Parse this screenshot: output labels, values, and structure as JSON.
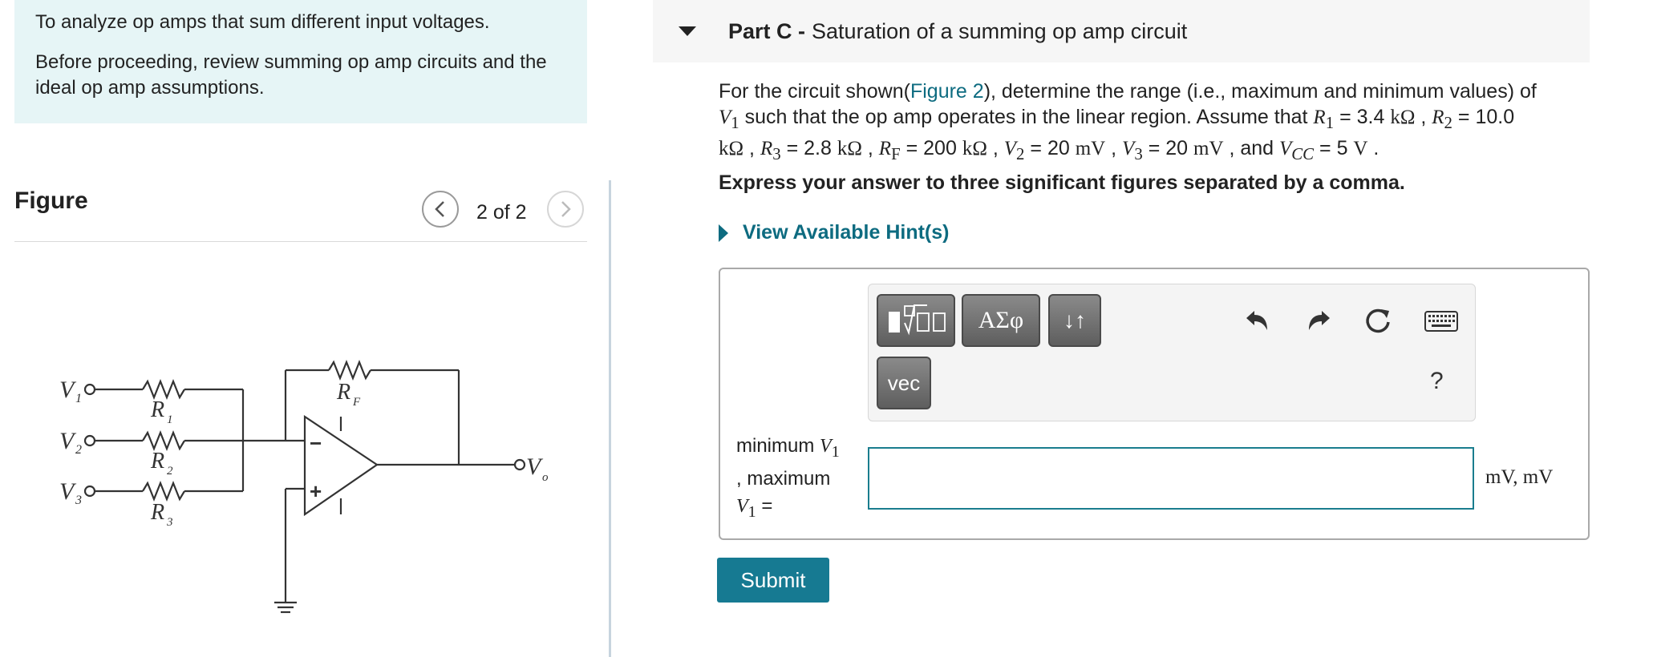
{
  "intro": {
    "line1": "To analyze op amps that sum different input voltages.",
    "line2": "Before proceeding, review summing op amp circuits and the ideal op amp assumptions."
  },
  "figure": {
    "title": "Figure",
    "page_indicator": "2 of 2",
    "labels": {
      "v1": "V",
      "v1_sub": "1",
      "v2": "V",
      "v2_sub": "2",
      "v3": "V",
      "v3_sub": "3",
      "r1": "R",
      "r1_sub": "1",
      "r2": "R",
      "r2_sub": "2",
      "r3": "R",
      "r3_sub": "3",
      "rf": "R",
      "rf_sub": "F",
      "vo": "V",
      "vo_sub": "o",
      "minus": "−",
      "plus": "+"
    }
  },
  "part": {
    "label": "Part C -",
    "title": "Saturation of a summing op amp circuit"
  },
  "question": {
    "t1": "For the circuit shown(",
    "figure_link": "Figure 2",
    "t2": "), determine the range (i.e., maximum and minimum values) of",
    "v1_sym": "V",
    "v1_sub": "1",
    "t3": " such that the op amp operates in the linear region. Assume that ",
    "r1_sym": "R",
    "r1_sub": "1",
    "r1_val": " = 3.4 ",
    "r1_unit": "kΩ",
    "r2_sym": "R",
    "r2_sub": "2",
    "r2_val": " = 10.0",
    "r2_unit": "kΩ",
    "r3_sym": "R",
    "r3_sub": "3",
    "r3_val": " = 2.8 ",
    "r3_unit": "kΩ",
    "rf_sym": "R",
    "rf_sub": "F",
    "rf_val": " = 200 ",
    "rf_unit": "kΩ",
    "v2_sym": "V",
    "v2_sub": "2",
    "v2_val": " = 20 ",
    "v2_unit": "mV",
    "v3_sym": "V",
    "v3_sub": "3",
    "v3_val": " = 20 ",
    "v3_unit": "mV",
    "and": " , and ",
    "vcc_sym": "V",
    "vcc_sub": "CC",
    "vcc_val": " = 5 ",
    "vcc_unit": "V",
    "sep": " , ",
    "end": " ."
  },
  "instruction": "Express your answer to three significant figures separated by a comma.",
  "hint": "View Available Hint(s)",
  "toolbar": {
    "greek": "ΑΣφ",
    "arrows": "↓↑",
    "vec": "vec",
    "help": "?"
  },
  "answer": {
    "label_pre": "minimum ",
    "label_sym1": "V",
    "label_sub1": "1",
    "label_mid": ", maximum",
    "label_sym2": "V",
    "label_sub2": "1",
    "label_post": " =",
    "value": "",
    "units": "mV, mV"
  },
  "submit_label": "Submit",
  "colors": {
    "accent": "#167a92",
    "link": "#0d6b80",
    "intro_bg": "#e6f5f6"
  }
}
